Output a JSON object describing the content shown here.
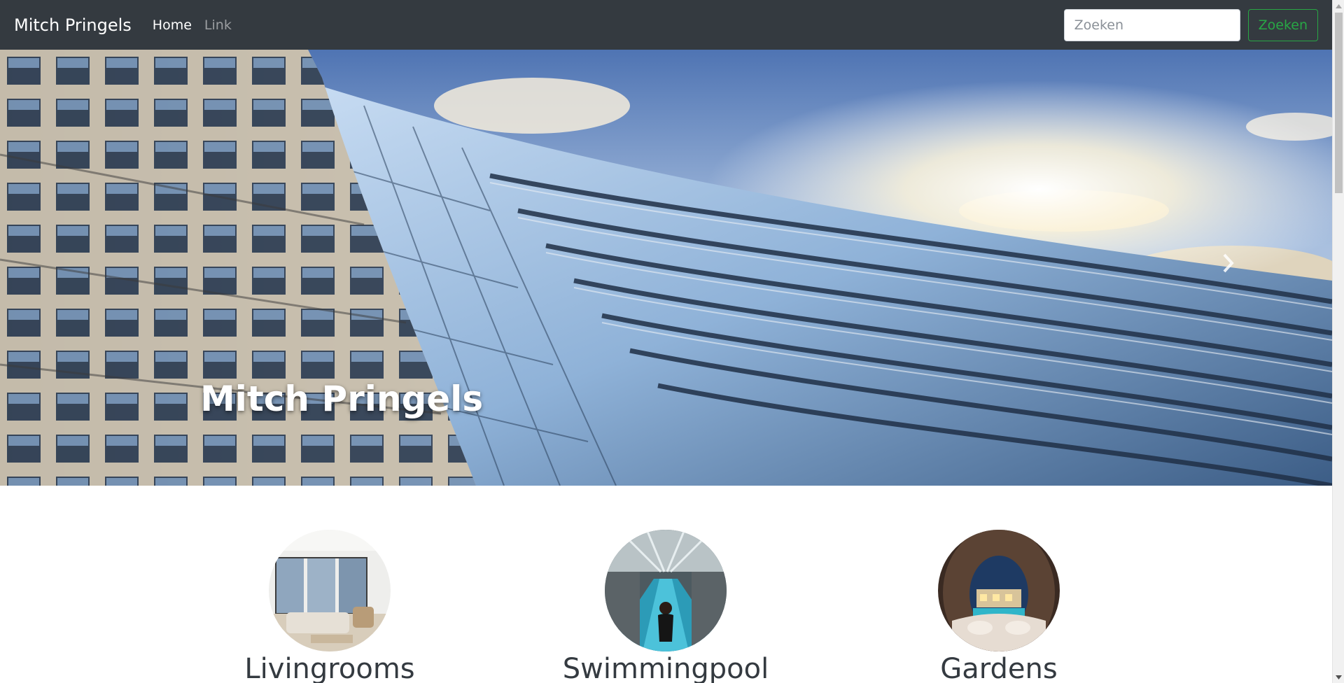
{
  "navbar": {
    "brand": "Mitch Pringels",
    "links": [
      {
        "label": "Home",
        "active": true
      },
      {
        "label": "Link",
        "active": false
      }
    ],
    "search": {
      "placeholder": "Zoeken",
      "value": "",
      "button_label": "Zoeken"
    },
    "colors": {
      "background": "#343a40",
      "search_button": "#28a745"
    }
  },
  "carousel": {
    "caption": "Mitch Pringels",
    "next_icon": "chevron-right-icon"
  },
  "features": [
    {
      "title": "Livingrooms",
      "image": "livingroom-image"
    },
    {
      "title": "Swimmingpool",
      "image": "swimmingpool-image"
    },
    {
      "title": "Gardens",
      "image": "garden-image"
    }
  ]
}
